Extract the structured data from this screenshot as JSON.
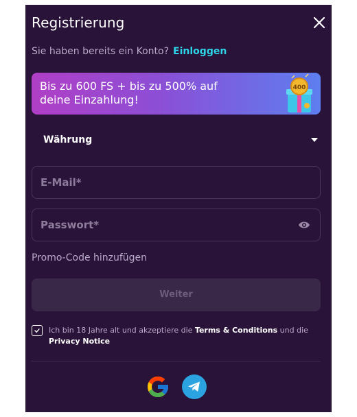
{
  "modal": {
    "title": "Registrierung",
    "close_icon": "close-icon"
  },
  "login": {
    "prompt": "Sie haben bereits ein Konto?",
    "link": "Einloggen"
  },
  "banner": {
    "line1": "Bis zu 600 FS + bis zu 500% auf",
    "line2": "deine Einzahlung!",
    "gift_badge": "400"
  },
  "currency": {
    "label": "Währung",
    "icon": "chevron-down-icon"
  },
  "email": {
    "value": "",
    "placeholder": "E-Mail*"
  },
  "password": {
    "value": "",
    "placeholder": "Passwort*",
    "icon": "eye-icon"
  },
  "promo": {
    "label": "Promo-Code hinzufügen"
  },
  "submit": {
    "label": "Weiter"
  },
  "terms": {
    "checked": true,
    "text_before": "Ich bin 18 Jahre alt und akzeptiere die ",
    "terms_link": "Terms & Conditions",
    "text_middle": " und die ",
    "privacy_link": "Privacy Notice"
  },
  "social": {
    "google_icon": "google-icon",
    "telegram_icon": "telegram-icon"
  },
  "colors": {
    "modal_bg": "#2a1338",
    "accent_link": "#2bd4e6",
    "banner_start": "#b03fc6",
    "banner_end": "#5d7ef0",
    "field_border": "#4a3457",
    "button_disabled": "#3a2848"
  }
}
